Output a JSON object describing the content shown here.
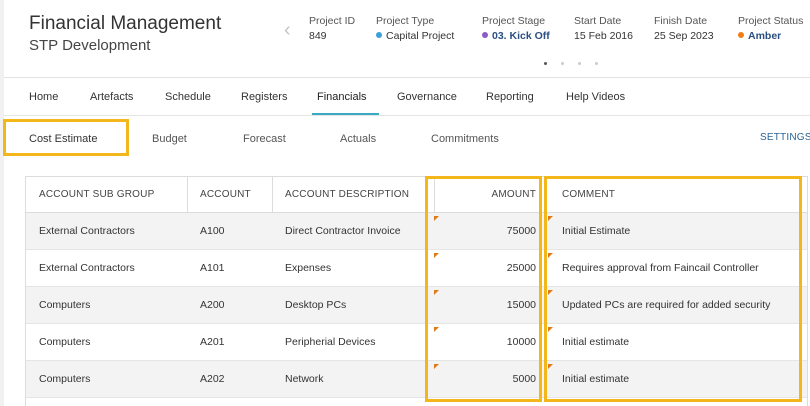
{
  "header": {
    "title": "Financial Management",
    "subtitle": "STP Development",
    "meta": [
      {
        "label": "Project ID",
        "value": "849"
      },
      {
        "label": "Project Type",
        "value": "Capital Project",
        "dot_color": "#3aa0dc"
      },
      {
        "label": "Project Stage",
        "value": "03. Kick Off",
        "dot_color": "#8b5cc6"
      },
      {
        "label": "Start Date",
        "value": "15 Feb 2016"
      },
      {
        "label": "Finish Date",
        "value": "25 Sep 2023"
      },
      {
        "label": "Project Status",
        "value": "Amber",
        "dot_color": "#ef7d1a"
      }
    ]
  },
  "main_tabs": [
    "Home",
    "Artefacts",
    "Schedule",
    "Registers",
    "Financials",
    "Governance",
    "Reporting",
    "Help Videos"
  ],
  "active_main_tab": "Financials",
  "sub_tabs": [
    "Cost Estimate",
    "Budget",
    "Forecast",
    "Actuals",
    "Commitments"
  ],
  "active_sub_tab": "Cost Estimate",
  "settings_label": "SETTINGS",
  "table": {
    "columns": [
      "ACCOUNT SUB GROUP",
      "ACCOUNT",
      "ACCOUNT DESCRIPTION",
      "AMOUNT",
      "COMMENT"
    ],
    "rows": [
      [
        "External Contractors",
        "A100",
        "Direct Contractor Invoice",
        "75000",
        "Initial Estimate"
      ],
      [
        "External Contractors",
        "A101",
        "Expenses",
        "25000",
        "Requires approval from Faincail Controller"
      ],
      [
        "Computers",
        "A200",
        "Desktop PCs",
        "15000",
        "Updated PCs are required for added security"
      ],
      [
        "Computers",
        "A201",
        "Peripherial Devices",
        "10000",
        "Initial estimate"
      ],
      [
        "Computers",
        "A202",
        "Network",
        "5000",
        "Initial estimate"
      ]
    ]
  },
  "colors": {
    "highlight": "#f3b61b",
    "accent": "#3aa9c3",
    "edited_flag": "#e07b1a",
    "row_alt": "#f3f3f3"
  },
  "icons": [
    "chevron-left-icon",
    "edited-cell-flag-icon"
  ]
}
